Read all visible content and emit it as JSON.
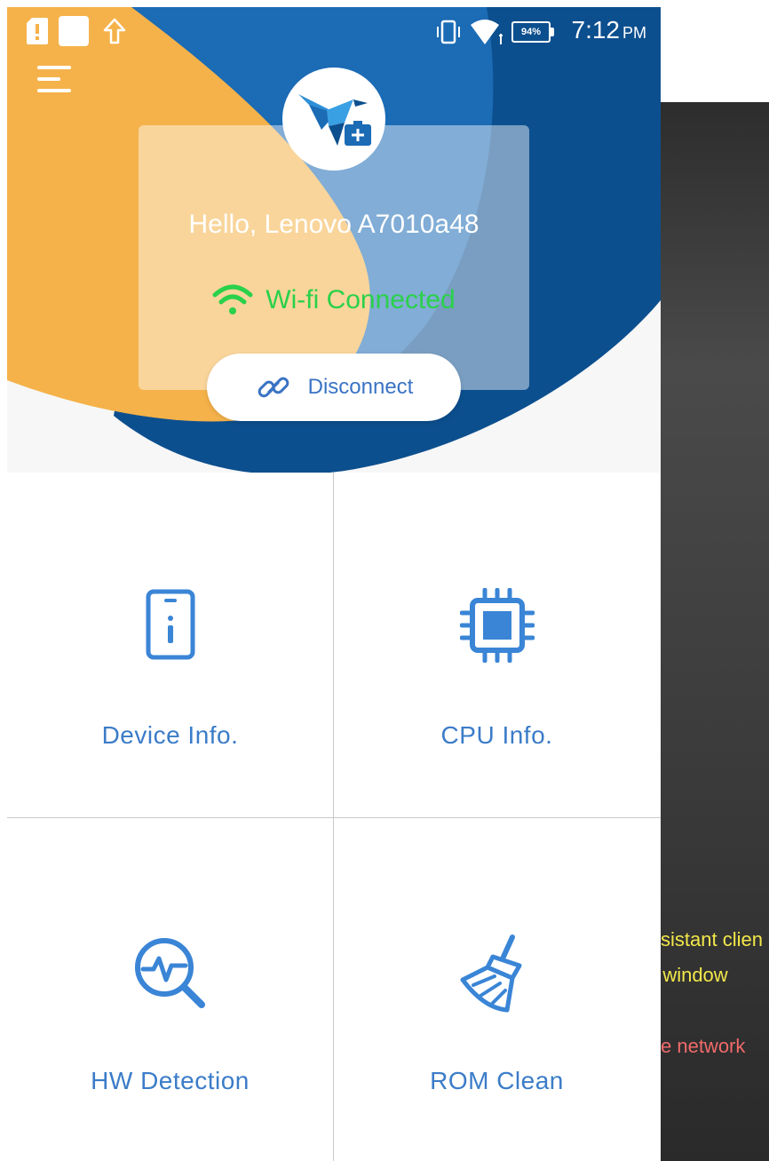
{
  "status_bar": {
    "battery": "94%",
    "time": "7:12",
    "ampm": "PM"
  },
  "header": {
    "greeting": "Hello, Lenovo A7010a48",
    "connection_status": "Wi-fi Connected",
    "disconnect_label": "Disconnect"
  },
  "tiles": [
    {
      "label": "Device Info.",
      "icon": "phone-info-icon"
    },
    {
      "label": "CPU Info.",
      "icon": "cpu-chip-icon"
    },
    {
      "label": "HW Detection",
      "icon": "hw-detection-icon"
    },
    {
      "label": "ROM Clean",
      "icon": "broom-icon"
    }
  ],
  "background": {
    "line1": "sistant clien",
    "line2": "' window",
    "line3": "e network"
  },
  "colors": {
    "primary_blue": "#1b6bb5",
    "dark_blue": "#0c4f8e",
    "orange": "#f5b24a",
    "wifi_green": "#2ad14a",
    "tile_text": "#3b7cc8"
  }
}
